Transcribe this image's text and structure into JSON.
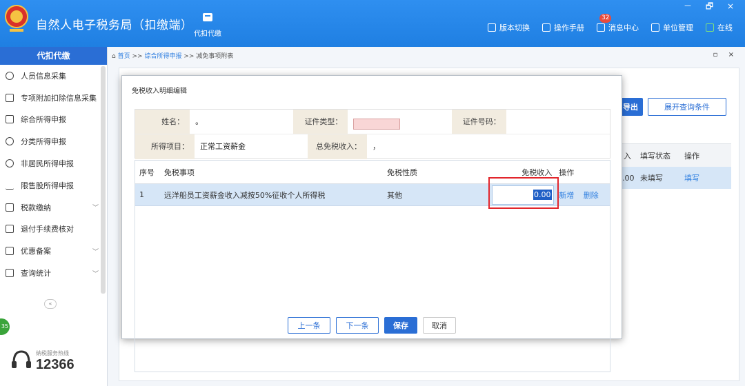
{
  "app": {
    "title": "自然人电子税务局（扣缴端）",
    "logo_text": "中国税务",
    "header_tab": "代扣代缴",
    "tools": [
      {
        "label": "版本切换",
        "icon": "version-switch-icon"
      },
      {
        "label": "操作手册",
        "icon": "manual-icon"
      },
      {
        "label": "消息中心",
        "icon": "message-icon",
        "badge": "32"
      },
      {
        "label": "单位管理",
        "icon": "unit-manage-icon"
      },
      {
        "label": "在线",
        "icon": "online-icon"
      }
    ],
    "window_controls": "－ 🗗 ×"
  },
  "sidebar": {
    "header": "代扣代缴",
    "items": [
      {
        "label": "人员信息采集",
        "icon": "person-icon"
      },
      {
        "label": "专项附加扣除信息采集",
        "icon": "list-icon"
      },
      {
        "label": "综合所得申报",
        "icon": "layers-icon"
      },
      {
        "label": "分类所得申报",
        "icon": "clock-icon"
      },
      {
        "label": "非居民所得申报",
        "icon": "person-plus-icon"
      },
      {
        "label": "限售股所得申报",
        "icon": "bar-chart-icon"
      },
      {
        "label": "税款缴纳",
        "icon": "folder-icon",
        "arrow": "﹀"
      },
      {
        "label": "退付手续费核对",
        "icon": "doc-icon"
      },
      {
        "label": "优惠备案",
        "icon": "file-icon",
        "arrow": "﹀"
      },
      {
        "label": "查询统计",
        "icon": "query-icon",
        "arrow": "﹀"
      }
    ],
    "collapse_glyph": "«",
    "green_badge": "35",
    "hotline_label": "纳税服务热线",
    "hotline_number": "12366"
  },
  "breadcrumb": {
    "home": "首页",
    "sep": ">>",
    "level2": "综合所得申报",
    "level3": "减免事项附表"
  },
  "page_controls": "▫ ×",
  "background": {
    "export_label": "导出",
    "expand_label": "展开查询条件",
    "table_headers": [
      "入",
      "填写状态",
      "操作"
    ],
    "table_row": [
      ".00",
      "未填写",
      "填写"
    ]
  },
  "modal": {
    "title": "免税收入明细编辑",
    "info": {
      "name_label": "姓名：",
      "name_value": "。",
      "id_type_label": "证件类型：",
      "id_number_label": "证件号码：",
      "id_number_value": "",
      "income_item_label": "所得项目：",
      "income_item_value": "正常工资薪金",
      "total_exempt_label": "总免税收入：",
      "total_exempt_value": "，"
    },
    "table": {
      "headers": {
        "seq": "序号",
        "item": "免税事项",
        "nature": "免税性质",
        "income": "免税收入",
        "op": "操作"
      },
      "rows": [
        {
          "seq": "1",
          "item": "远洋船员工资薪金收入减按50%征收个人所得税",
          "nature": "其他",
          "income": "0.00",
          "op_add": "新增",
          "op_delete": "删除"
        }
      ]
    },
    "buttons": {
      "prev": "上一条",
      "next": "下一条",
      "save": "保存",
      "cancel": "取消"
    }
  },
  "colors": {
    "header_blue": "#1f7fe2",
    "primary": "#2a6ed5",
    "highlight_red": "#e2262c",
    "row_selected": "#d6e6f7",
    "pink_field": "#f9d6d6"
  }
}
